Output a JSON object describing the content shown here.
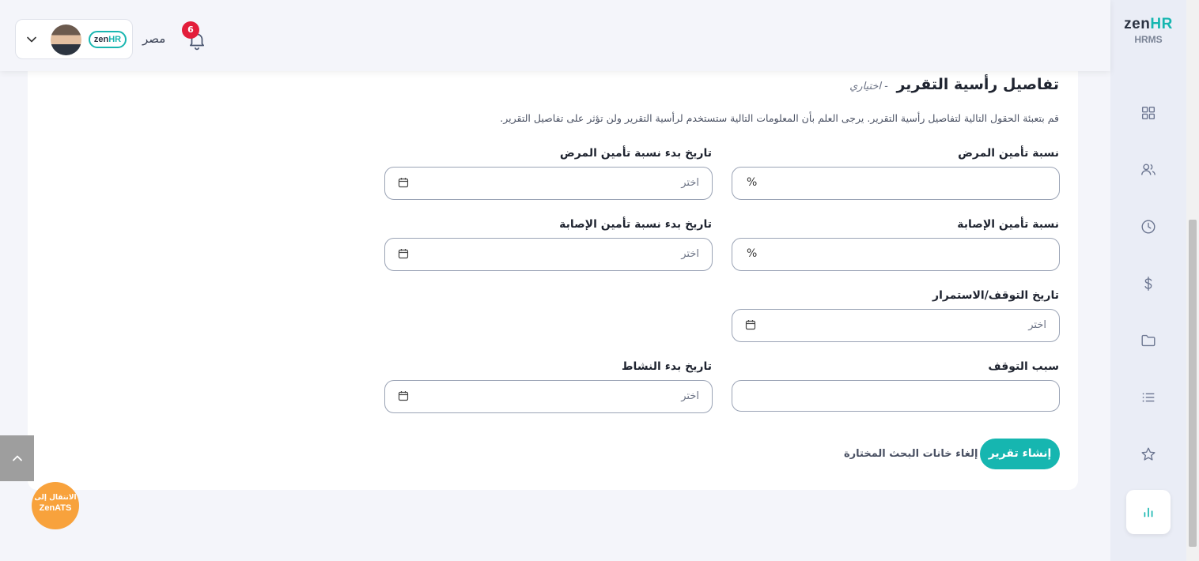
{
  "header": {
    "country": "مصر",
    "notification_count": "6",
    "logo_zen": "zen",
    "logo_hr": "HR"
  },
  "sidebar": {
    "brand_zen": "zen",
    "brand_hr": "HR",
    "brand_sub": "HRMS",
    "items": [
      {
        "icon": "dashboard-icon"
      },
      {
        "icon": "users-icon"
      },
      {
        "icon": "clock-icon"
      },
      {
        "icon": "dollar-icon"
      },
      {
        "icon": "folder-icon"
      },
      {
        "icon": "list-icon"
      },
      {
        "icon": "star-icon"
      },
      {
        "icon": "chart-icon",
        "active": true
      }
    ]
  },
  "section": {
    "title": "تفاصيل رأسية التقرير",
    "optional": "- اختياري",
    "description": "قم بتعبئة الحقول التالية لتفاصيل رأسية التقرير. يرجى العلم بأن المعلومات التالية ستستخدم لرأسية التقرير ولن تؤثر على تفاصيل التقرير."
  },
  "fields": {
    "sick_insurance_rate": {
      "label": "نسبة تأمين المرض",
      "suffix": "%"
    },
    "sick_insurance_start": {
      "label": "تاريخ بدء نسبة تأمين المرض",
      "placeholder": "اختر"
    },
    "injury_insurance_rate": {
      "label": "نسبة تأمين الإصابة",
      "suffix": "%"
    },
    "injury_insurance_start": {
      "label": "تاريخ بدء نسبة تأمين الإصابة",
      "placeholder": "اختر"
    },
    "stop_continue_date": {
      "label": "تاريخ التوقف/الاستمرار",
      "placeholder": "اختر"
    },
    "stop_reason": {
      "label": "سبب التوقف"
    },
    "activity_start": {
      "label": "تاريخ بدء النشاط",
      "placeholder": "اختر"
    }
  },
  "actions": {
    "create_report": "إنشاء تقرير",
    "clear_search": "إلغاء خانات البحث المختارة"
  },
  "widgets": {
    "ats_line1": "الانتقال إلى",
    "ats_line2": "ZenATS"
  },
  "colors": {
    "accent": "#16b6b0",
    "badge": "#e31d3a",
    "ats": "#f8a23c"
  }
}
